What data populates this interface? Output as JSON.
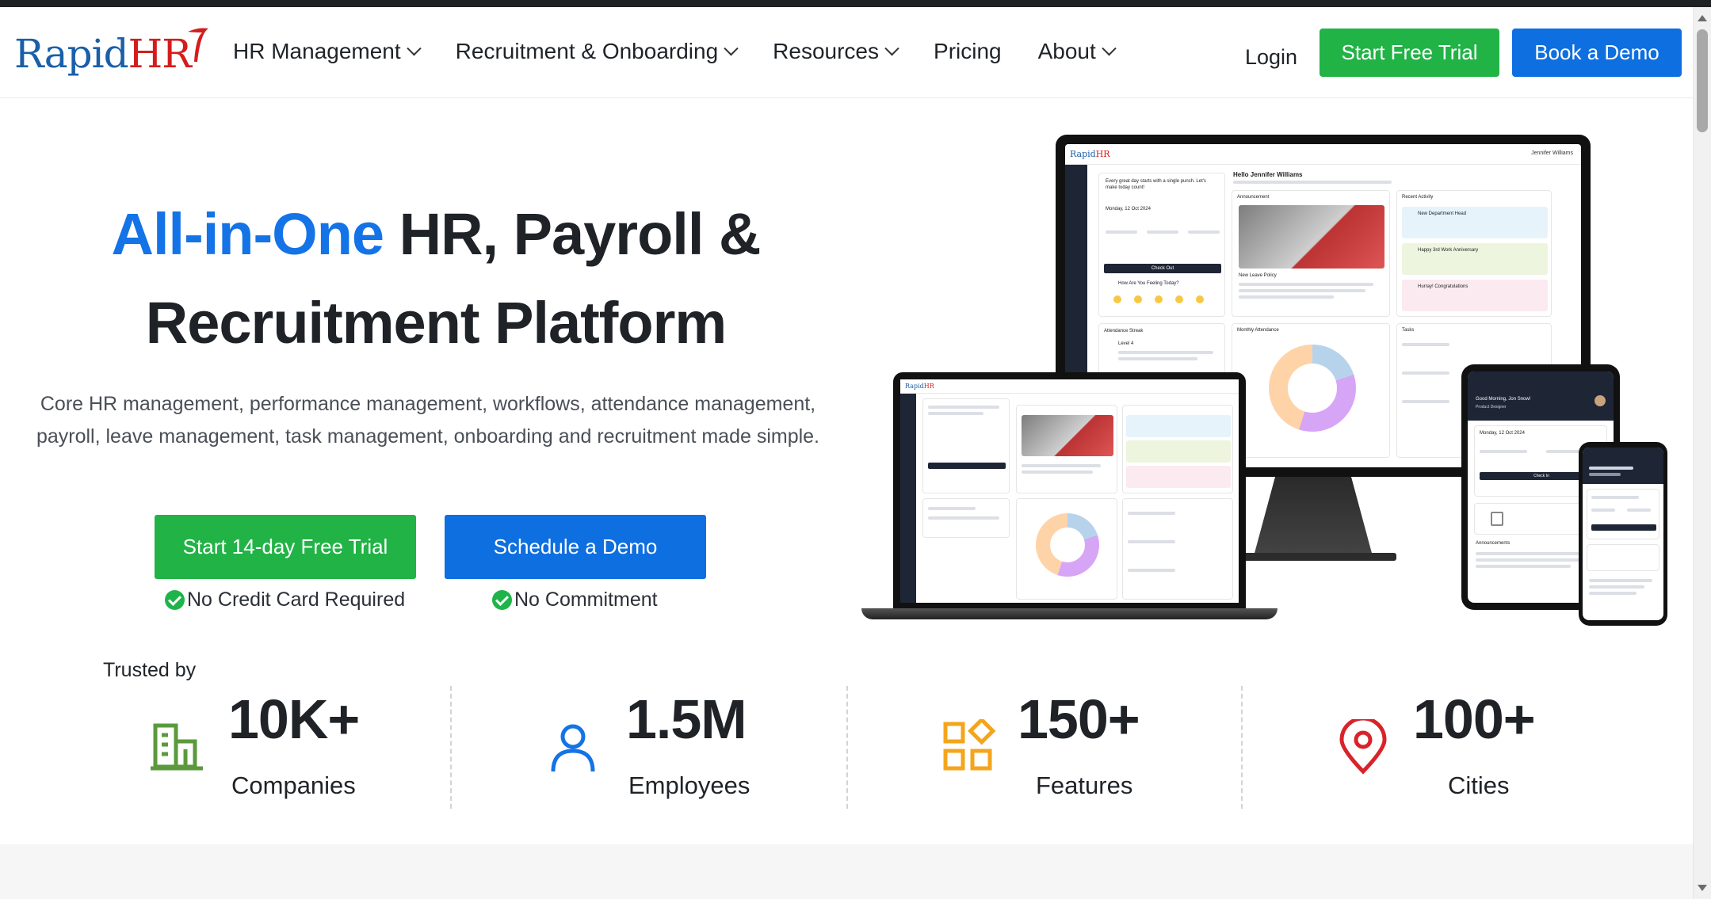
{
  "brand": {
    "name_part1": "Rapid",
    "name_part2": "HR"
  },
  "nav": {
    "items": [
      {
        "label": "HR Management",
        "has_menu": true
      },
      {
        "label": "Recruitment & Onboarding",
        "has_menu": true
      },
      {
        "label": "Resources",
        "has_menu": true
      },
      {
        "label": "Pricing",
        "has_menu": false
      },
      {
        "label": "About",
        "has_menu": true
      }
    ],
    "login_label": "Login",
    "trial_label": "Start Free Trial",
    "demo_label": "Book a Demo"
  },
  "hero": {
    "title_accent": "All-in-One",
    "title_rest_line1": " HR, Payroll &",
    "title_line2": "Recruitment Platform",
    "subtitle": "Core HR management, performance management, workflows, attendance management, payroll, leave management, task management, onboarding and recruitment made simple.",
    "cta_trial": "Start 14-day Free Trial",
    "cta_demo": "Schedule a Demo",
    "note_trial": "No Credit Card Required",
    "note_demo": "No Commitment"
  },
  "trusted": {
    "label": "Trusted by",
    "stats": [
      {
        "value": "10K+",
        "label": "Companies",
        "icon": "building-icon",
        "color": "#5b9a3c"
      },
      {
        "value": "1.5M",
        "label": "Employees",
        "icon": "user-icon",
        "color": "#1473e6"
      },
      {
        "value": "150+",
        "label": "Features",
        "icon": "features-grid-icon",
        "color": "#f4a51c"
      },
      {
        "value": "100+",
        "label": "Cities",
        "icon": "location-pin-icon",
        "color": "#d8232a"
      }
    ]
  },
  "colors": {
    "green": "#21b346",
    "blue": "#0e6fe0",
    "accent": "#1473e6",
    "logo_blue": "#1a5fa8",
    "logo_red": "#d31d1d"
  },
  "devices_preview": {
    "monitor": {
      "greeting": "Hello Jennifer Williams",
      "user_name": "Jennifer Williams",
      "punch_note": "Every great day starts with a single punch. Let's make today count!",
      "date": "Monday, 12 Oct 2024",
      "check_out": "Check Out",
      "feeling": "How Are You Feeling Today?",
      "announcement": "Announcement",
      "recent_activity": "Recent Activity",
      "activity_1": "New Department Head",
      "activity_2": "Happy 3rd Work Anniversary",
      "activity_3": "Hurray! Congratulations",
      "policy": "New Leave Policy",
      "monthly_attendance": "Monthly Attendance",
      "attendance_streak": "Attendance Streak",
      "level": "Level 4",
      "tasks": "Tasks"
    },
    "tablet": {
      "greeting": "Good Morning, Jon Snow!",
      "role": "Product Designer",
      "date": "Monday, 12 Oct 2024",
      "check_in": "Check In",
      "announcements": "Announcements"
    }
  }
}
